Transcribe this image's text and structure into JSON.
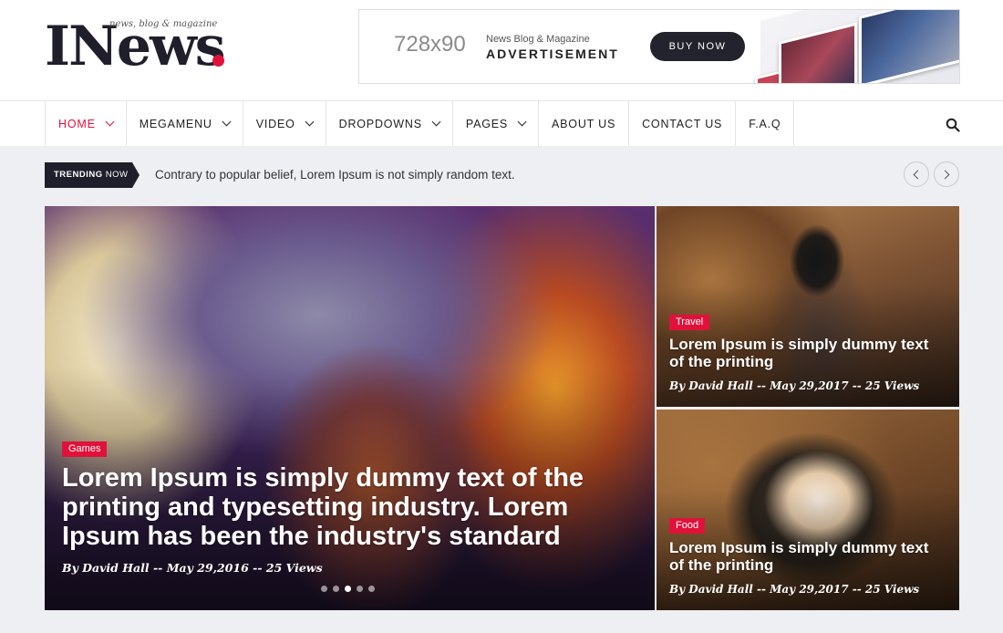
{
  "header": {
    "logo_text": "INews",
    "logo_tagline": "news, blog & magazine",
    "ad": {
      "size": "728x90",
      "sub": "News Blog & Magazine",
      "main": "ADVERTISEMENT",
      "button": "BUY NOW"
    }
  },
  "nav": {
    "items": [
      {
        "label": "HOME",
        "dropdown": true,
        "active": true
      },
      {
        "label": "MEGAMENU",
        "dropdown": true
      },
      {
        "label": "VIDEO",
        "dropdown": true
      },
      {
        "label": "DROPDOWNS",
        "dropdown": true
      },
      {
        "label": "PAGES",
        "dropdown": true
      },
      {
        "label": "ABOUT US",
        "dropdown": false
      },
      {
        "label": "CONTACT US",
        "dropdown": false
      },
      {
        "label": "F.A.Q",
        "dropdown": false
      }
    ],
    "search_icon": "search-icon"
  },
  "trending": {
    "label_bold": "TRENDING",
    "label_rest": "NOW",
    "text": "Contrary to popular belief, Lorem Ipsum is not simply random text."
  },
  "featured": {
    "main": {
      "category": "Games",
      "title": "Lorem Ipsum is simply dummy text of the printing and typesetting industry. Lorem Ipsum has been the industry's standard",
      "meta": "By David Hall -- May 29,2016 -- 25 Views",
      "slides": 5,
      "active_slide": 3
    },
    "side": [
      {
        "category": "Travel",
        "title": "Lorem Ipsum is simply dummy text of the printing",
        "meta": "By David Hall -- May 29,2017 -- 25 Views"
      },
      {
        "category": "Food",
        "title": "Lorem Ipsum is simply dummy text of the printing",
        "meta": "By David Hall -- May 29,2017 -- 25 Views"
      }
    ]
  },
  "colors": {
    "accent": "#e0123a",
    "dark": "#1f1f2b",
    "page_bg": "#eeeff3"
  }
}
